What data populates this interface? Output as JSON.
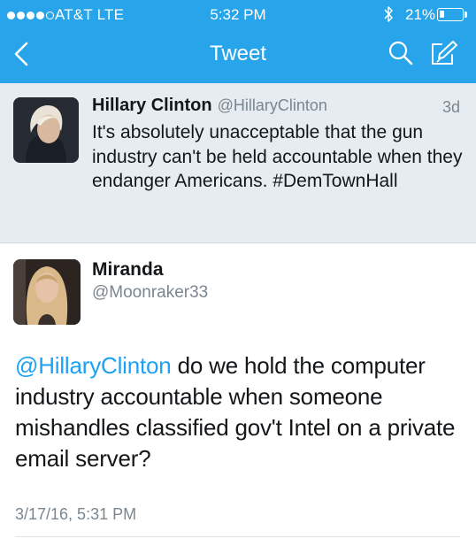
{
  "status_bar": {
    "carrier": "AT&T  LTE",
    "time": "5:32 PM",
    "battery_percent": "21%",
    "battery_level": 0.21,
    "signal_bars_filled": 4,
    "signal_bars_total": 5
  },
  "nav": {
    "title": "Tweet",
    "back_icon": "chevron-left-icon",
    "search_icon": "search-icon",
    "compose_icon": "compose-icon"
  },
  "quoted_tweet": {
    "name": "Hillary Clinton",
    "handle": "@HillaryClinton",
    "time": "3d",
    "text": "It's absolutely unacceptable that the gun industry can't be held accountable when they endanger Americans. #DemTownHall"
  },
  "tweet": {
    "name": "Miranda",
    "handle": "@Moonraker33",
    "mention": "@HillaryClinton",
    "text": " do we hold the computer industry accountable when someone mishandles classified gov't Intel on a private email server?",
    "timestamp": "3/17/16, 5:31 PM"
  },
  "colors": {
    "nav_bar": "#27a4ea",
    "link": "#1da1f2",
    "quoted_bg": "#e6ecf0",
    "secondary_text": "#7a8690"
  }
}
